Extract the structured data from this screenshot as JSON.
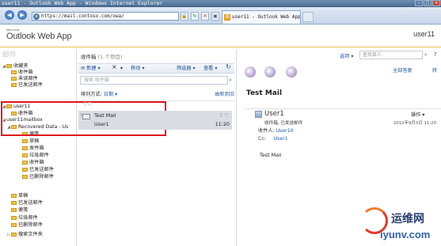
{
  "browser": {
    "title": "user11 - Outlook Web App - Windows Internet Explorer",
    "url": "https://mail.contoso.com/owa/",
    "tab_title": "user11 - Outlook Web App"
  },
  "header": {
    "brand_small": "Microsoft",
    "brand": "Outlook Web App",
    "user": "user11"
  },
  "nav": {
    "section_title": "邮件",
    "favorites_label": "收藏夹",
    "favorites": [
      "收件箱",
      "未读邮件",
      "已发送邮件"
    ],
    "mailbox_user": "user11",
    "mailbox_user_items": [
      "收件箱"
    ],
    "mailbox_2": "user11mailbox",
    "recovered": "Recovered Data - Us",
    "recovered_items": [
      "便笺",
      "草稿",
      "发件箱",
      "垃圾邮件",
      "收件箱",
      "已发送邮件",
      "已删除邮件"
    ],
    "root_items": [
      "草稿",
      "已发送邮件",
      "便笺",
      "垃圾邮件",
      "已删除邮件"
    ],
    "search_folders": "搜索文件夹"
  },
  "list": {
    "title": "收件箱",
    "count": "(1 个项目)",
    "new_label": "新建",
    "delete_label": "×",
    "move_label": "移动",
    "filter_label": "筛选器",
    "view_label": "查看",
    "search_placeholder": "搜索 收件箱",
    "sort_label": "排列方式:",
    "sort_value": "日期",
    "order_label": "由新到旧",
    "group_label": "今天",
    "items": [
      {
        "subject": "Test Mail",
        "from": "User1",
        "time": "11:20"
      }
    ]
  },
  "reading": {
    "options_label": "选项",
    "find_people_placeholder": "查找某人",
    "reply_all_label": "全部答复",
    "forward_label": "转",
    "subject": "Test Mail",
    "sender": "User1",
    "sent_on_behalf": "收件箱, 已发送邮件",
    "actions_label": "操作",
    "datetime": "2012年9月3日  11:20",
    "to_label": "收件人:",
    "to_value": "User10",
    "cc_label": "Cc:",
    "cc_value": "User1",
    "body": "Test Mail"
  },
  "watermark": {
    "line1": "运维网",
    "line2": "iyunv.com"
  }
}
